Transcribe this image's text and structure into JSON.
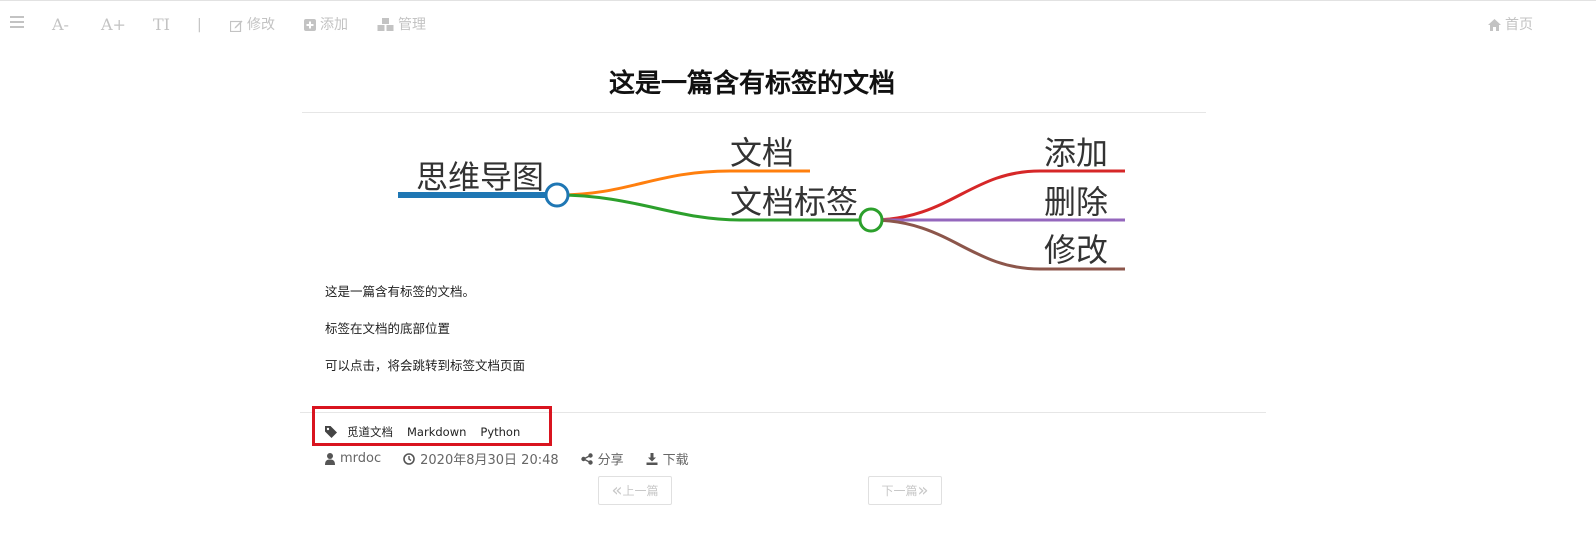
{
  "toolbar": {
    "font_decrease": "A-",
    "font_increase": "A+",
    "font_style": "TI",
    "separator": "|",
    "edit_label": "修改",
    "add_label": "添加",
    "manage_label": "管理",
    "home_label": "首页"
  },
  "doc": {
    "title": "这是一篇含有标签的文档",
    "paragraphs": [
      "这是一篇含有标签的文档。",
      "标签在文档的底部位置",
      "可以点击，将会跳转到标签文档页面"
    ]
  },
  "mindmap": {
    "root": "思维导图",
    "nodes": [
      "文档",
      "文档标签"
    ],
    "leaves": [
      "添加",
      "删除",
      "修改"
    ],
    "colors": {
      "root": "#1f77b4",
      "doc": "#ff7f0e",
      "tags": "#2ca02c",
      "add": "#d62728",
      "delete": "#9467bd",
      "edit": "#8c564b"
    }
  },
  "tags": [
    "觅道文档",
    "Markdown",
    "Python"
  ],
  "meta": {
    "author": "mrdoc",
    "datetime": "2020年8月30日 20:48",
    "share": "分享",
    "download": "下载"
  },
  "nav": {
    "prev": "上一篇",
    "next": "下一篇",
    "prev_chevron": "«",
    "next_chevron": "»"
  },
  "colors": {
    "highlight_box": "#d9141f",
    "toolbar_icon": "#c3c3c3"
  }
}
